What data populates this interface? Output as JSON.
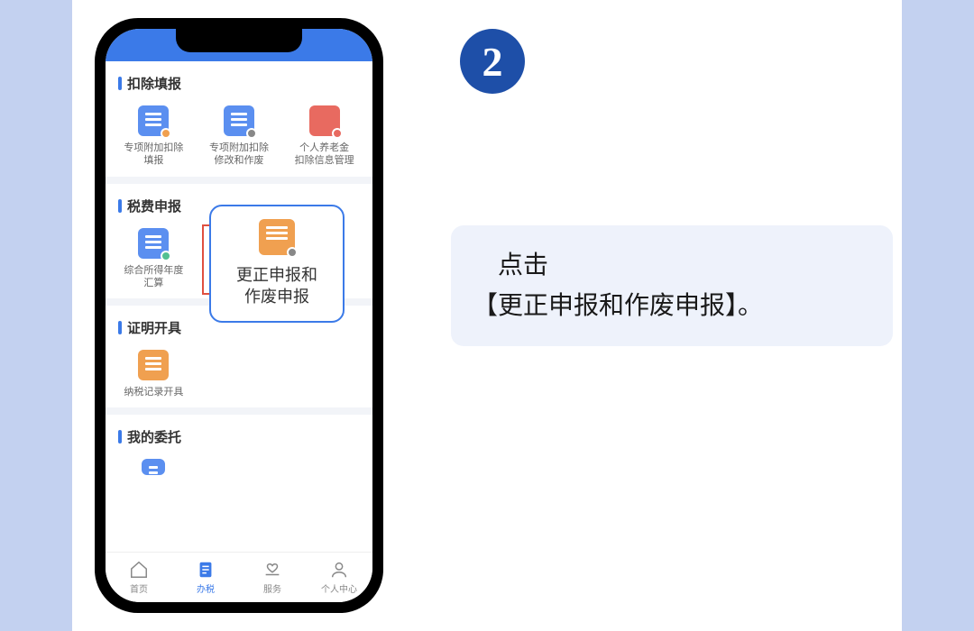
{
  "step_number": "2",
  "instruction": {
    "line1": "　点击",
    "line2": "【更正申报和作废申报】。"
  },
  "bubble": {
    "line1": "更正申报和",
    "line2": "作废申报"
  },
  "sections": {
    "deduction": {
      "title": "扣除填报",
      "items": [
        {
          "label1": "专项附加扣除",
          "label2": "填报"
        },
        {
          "label1": "专项附加扣除",
          "label2": "修改和作废"
        },
        {
          "label1": "个人养老金",
          "label2": "扣除信息管理"
        }
      ]
    },
    "tax_filing": {
      "title": "税费申报",
      "items": [
        {
          "label1": "综合所得年度",
          "label2": "汇算"
        },
        {
          "label1": "更正申报和",
          "label2": "作废申报"
        }
      ]
    },
    "certificate": {
      "title": "证明开具",
      "items": [
        {
          "label1": "纳税记录开具",
          "label2": ""
        }
      ]
    },
    "delegation": {
      "title": "我的委托"
    }
  },
  "tabs": [
    {
      "label": "首页"
    },
    {
      "label": "办税"
    },
    {
      "label": "服务"
    },
    {
      "label": "个人中心"
    }
  ]
}
